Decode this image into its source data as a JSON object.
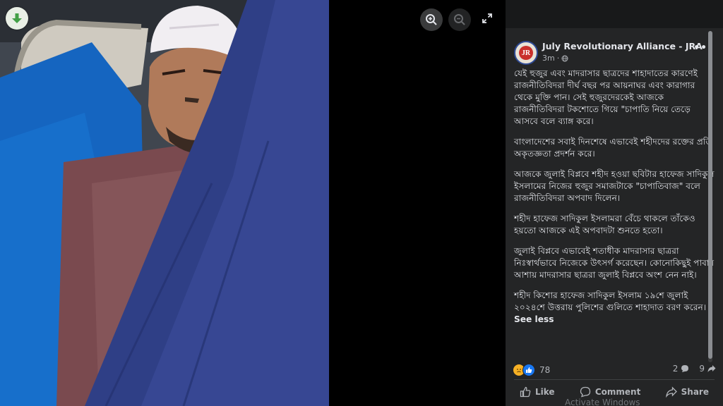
{
  "post": {
    "page_name": "July Revolutionary Alliance - JRA",
    "avatar_initials": "JR",
    "time": "3m",
    "paragraphs": [
      "যেই হুজুর এবং মাদরাসার ছাত্রদের শাহাদাতের কারণেই রাজনীতিবিদরা দীর্ঘ বছর পর আয়নাঘর এবং কারাগার থেকে মুক্তি পান। সেই হুজুরদেরকেই আজকে রাজনীতিবিদরা টকশোতে গিয়ে \"চাপাতি নিয়ে তেড়ে আসবে বলে ব্যাঙ্গ করে।",
      "বাংলাদেশের সবাই দিনশেষে এভাবেই শহীদদের রক্তের প্রতি অকৃতজ্ঞতা প্রদর্শন করে।",
      "আজকে জুলাই বিপ্লবে শহীদ হওয়া ছবিটার হাফেজ সাদিকুল ইসলামের নিজের হুজুর সমাজটাকে \"চাপাতিবাজ\" বলে রাজনীতিবিদরা অপবাদ দিলেন।",
      "শহীদ হাফেজ সাদিকুল ইসলামরা বেঁচে থাকলে তাঁকেও হয়তো আজকে এই অপবাদটা শুনতে হতো।",
      "জুলাই বিপ্লবে এভাবেই শতাধীক মাদরাসার ছাত্ররা নিঃস্বার্থভাবে নিজেকে উৎসর্গ করেছেন। কোনোকিছুই পাবার আশায় মাদরাসার ছাত্ররা জুলাই বিপ্লবে অংশ নেন নাই।",
      "শহীদ কিশোর হাফেজ সাদিকুল ইসলাম ১৯শে জুলাই ২০২৪শে উত্তরায় পুলিশের গুলিতে শাহাদাত বরণ করেন।"
    ],
    "see_less": "See less",
    "reaction_count": "78",
    "comment_count": "2",
    "share_count": "9"
  },
  "actions": {
    "like": "Like",
    "comment": "Comment",
    "share": "Share"
  },
  "watermark": "Activate Windows",
  "icons": {
    "download": "download-arrow-icon",
    "zoom_in": "zoom-in-icon",
    "zoom_out": "zoom-out-icon",
    "expand": "expand-icon",
    "globe": "globe-icon",
    "more": "more-options-icon",
    "sad": "sad-reaction-icon",
    "like": "like-reaction-icon"
  },
  "colors": {
    "panel_bg": "#242526",
    "accent_blue": "#1877f2",
    "download_green": "#43a047"
  }
}
